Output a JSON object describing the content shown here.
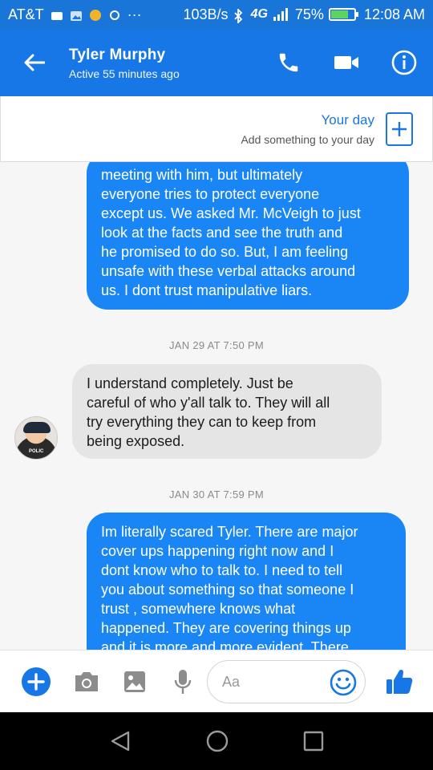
{
  "status_bar": {
    "carrier": "AT&T",
    "speed": "103B/s",
    "network": "4G",
    "network_sub": "LTE",
    "battery": "75%",
    "battery_level": 0.75,
    "time": "12:08 AM"
  },
  "header": {
    "contact_name": "Tyler Murphy",
    "presence": "Active 55 minutes ago"
  },
  "your_day": {
    "title": "Your day",
    "subtitle": "Add something to your day"
  },
  "messages": [
    {
      "direction": "outgoing",
      "lines": [
        "meeting with him, but ultimately",
        "everyone tries to protect everyone",
        "except us. We asked Mr. McVeigh to just",
        "look at the facts and see the truth and",
        "he promised to do so. But, I am feeling",
        "unsafe with these verbal attacks around",
        "us. I dont trust manipulative liars."
      ]
    },
    {
      "type": "timestamp",
      "text": "JAN 29 AT 7:50 PM"
    },
    {
      "direction": "incoming",
      "lines": [
        "I understand completely. Just be",
        "careful of who y'all talk to. They will all",
        "try everything they can to keep from",
        "being exposed."
      ]
    },
    {
      "type": "timestamp",
      "text": "JAN 30 AT 7:59 PM"
    },
    {
      "direction": "outgoing",
      "lines": [
        "Im literally scared Tyler. There are major",
        "cover ups happening right now and I",
        "dont know who to talk to. I need to tell",
        "you about something so that someone I",
        "trust , somewhere knows what",
        "happened. They are covering things up",
        "and it is more and more evident. There"
      ]
    }
  ],
  "avatar": {
    "badge_text": "POLIC"
  },
  "composer": {
    "placeholder": "Aa"
  },
  "colors": {
    "header": "#1877e6",
    "outgoing_bubble": "#1a86f5",
    "incoming_bubble": "#e5e5e5"
  }
}
